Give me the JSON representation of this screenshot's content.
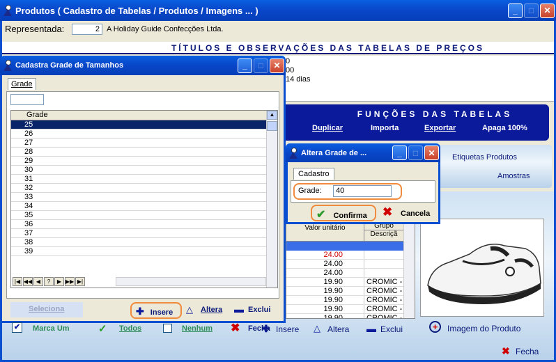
{
  "main": {
    "title": "Produtos ( Cadastro de Tabelas / Produtos / Imagens ... )",
    "representada_label": "Representada:",
    "representada_code": "2",
    "representada_name": "A Holiday Guide Confecções Ltda.",
    "titulos_header": "TÍTULOS  E  OBSERVAÇÕES  DAS  TABELAS  DE  PREÇOS",
    "obs_lines": [
      "0",
      "00",
      "14 dias"
    ],
    "funcoes_header": "FUNÇÕES  DAS  TABELAS",
    "funcoes": [
      "Duplicar",
      "Importa",
      "Exportar",
      "Apaga 100%"
    ],
    "etiquetas": "Etiquetas Produtos",
    "amostras": "Amostras",
    "col_valor": "Valor unitário",
    "col_grupo": "Grupo",
    "col_descr": "Descriçã",
    "rows": [
      {
        "valor": "24.00",
        "grupo": ""
      },
      {
        "valor": "24.00",
        "grupo": ""
      },
      {
        "valor": "24.00",
        "grupo": ""
      },
      {
        "valor": "19.90",
        "grupo": "CROMIC -"
      },
      {
        "valor": "19.90",
        "grupo": "CROMIC -"
      },
      {
        "valor": "19.90",
        "grupo": "CROMIC -"
      },
      {
        "valor": "19.90",
        "grupo": "CROMIC -"
      },
      {
        "valor": "19.90",
        "grupo": "CROMIC -"
      }
    ],
    "insere": "Insere",
    "altera": "Altera",
    "exclui": "Exclui",
    "imagem": "Imagem do Produto",
    "fecha": "Fecha"
  },
  "grade_win": {
    "title": "Cadastra Grade de Tamanhos",
    "tab": "Grade",
    "col_header": "Grade",
    "items": [
      "25",
      "26",
      "27",
      "28",
      "29",
      "30",
      "31",
      "32",
      "33",
      "34",
      "35",
      "36",
      "37",
      "38",
      "39"
    ],
    "nav": [
      "|◀",
      "◀◀",
      "◀",
      "?",
      "▶",
      "▶▶",
      "▶|"
    ],
    "seleciona": "Seleciona",
    "insere": "Insere",
    "altera": "Altera",
    "exclui": "Exclui",
    "marca_um": "Marca Um",
    "todos": "Todos",
    "nenhum": "Nenhum",
    "fecha": "Fecha"
  },
  "altera_win": {
    "title": "Altera Grade de ...",
    "tab": "Cadastro",
    "label": "Grade:",
    "value": "40",
    "confirma": "Confirma",
    "cancela": "Cancela"
  },
  "colors": {
    "accent": "#0a4fd0",
    "navy": "#0b1a7a",
    "orange": "#f08a3c",
    "red_price": "#d00000"
  }
}
